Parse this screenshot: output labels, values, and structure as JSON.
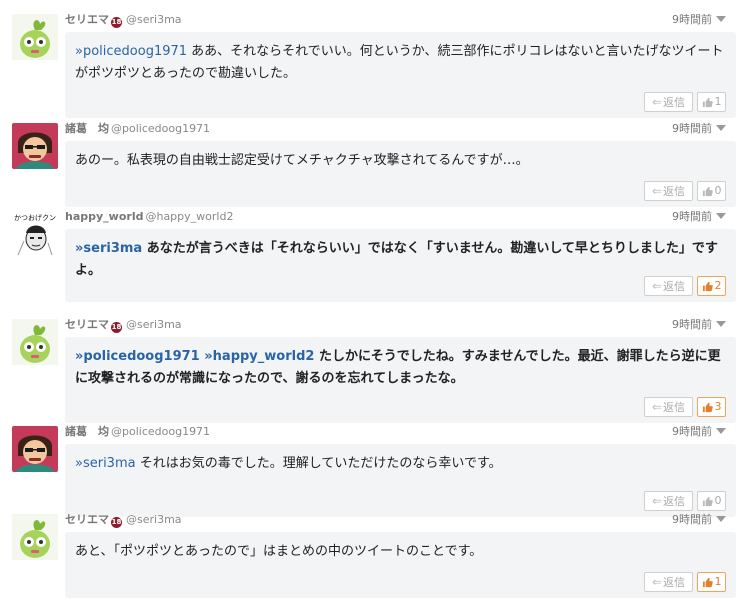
{
  "ui": {
    "reply_label": "返信",
    "colors": {
      "mention": "#2a64a5",
      "like_active": "#e3802b",
      "bubble_bg": "#f2f4f6"
    },
    "icons": {
      "reply": "reply-arrow-icon",
      "like": "thumbs-up-icon",
      "menu": "chevron-down-icon",
      "badge": "age-18-badge-icon"
    }
  },
  "comments": [
    {
      "user": "セリエマ",
      "badge": "18",
      "handle": "@seri3ma",
      "time": "9時間前",
      "mentions": [
        "»policedoog1971"
      ],
      "text": " ああ、それならそれでいい。何というか、続三部作にポリコレはないと言いたげなツイートがポツポツとあったので勘違いした。",
      "likes": "1",
      "liked": false
    },
    {
      "user": "諸葛　均",
      "handle": "@policedoog1971",
      "time": "9時間前",
      "mentions": [],
      "text": "あのー。私表現の自由戦士認定受けてメチャクチャ攻撃されてるんですが…。",
      "likes": "0",
      "liked": false
    },
    {
      "user": "happy_world",
      "handle": "@happy_world2",
      "time": "9時間前",
      "mentions": [
        "»seri3ma"
      ],
      "text": " あなたが言うべきは「それならいい」ではなく「すいません。勘違いして早とちりしました」ですよ。",
      "likes": "2",
      "liked": true
    },
    {
      "user": "セリエマ",
      "badge": "18",
      "handle": "@seri3ma",
      "time": "9時間前",
      "mentions": [
        "»policedoog1971",
        "»happy_world2"
      ],
      "text": " たしかにそうでしたね。すみませんでした。最近、謝罪したら逆に更に攻撃されるのが常識になったので、謝るのを忘れてしまったな。",
      "likes": "3",
      "liked": true
    },
    {
      "user": "諸葛　均",
      "handle": "@policedoog1971",
      "time": "9時間前",
      "mentions": [
        "»seri3ma"
      ],
      "text": " それはお気の毒でした。理解していただけたのなら幸いです。",
      "likes": "0",
      "liked": false
    },
    {
      "user": "セリエマ",
      "badge": "18",
      "handle": "@seri3ma",
      "time": "9時間前",
      "mentions": [],
      "text": "あと、「ポツポツとあったので」はまとめの中のツイートのことです。",
      "likes": "1",
      "liked": true
    }
  ]
}
